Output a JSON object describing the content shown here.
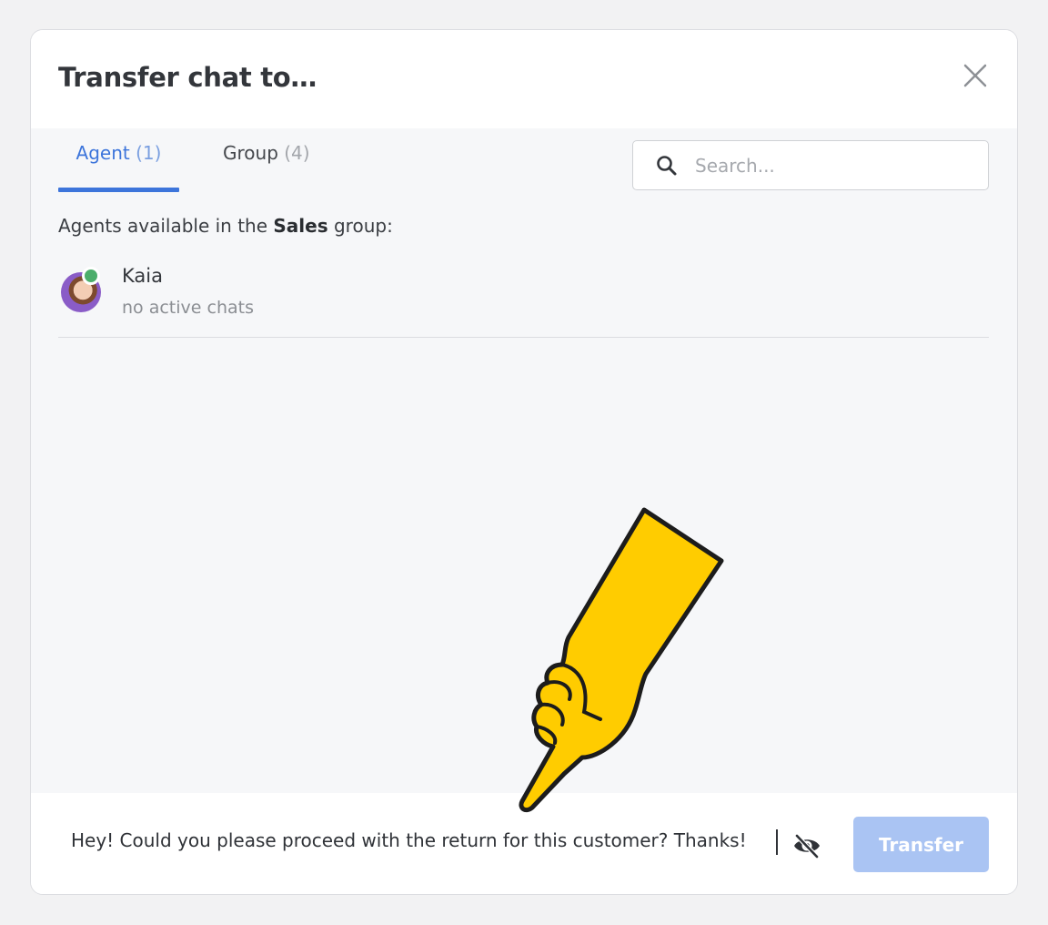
{
  "modal": {
    "title": "Transfer chat to…"
  },
  "tabs": [
    {
      "label": "Agent",
      "count": "(1)",
      "active": true
    },
    {
      "label": "Group",
      "count": "(4)",
      "active": false
    }
  ],
  "search": {
    "placeholder": "Search...",
    "value": ""
  },
  "caption": {
    "prefix": "Agents available in the ",
    "group_name": "Sales",
    "suffix": " group:"
  },
  "agents": [
    {
      "name": "Kaia",
      "status": "no active chats",
      "online": true
    }
  ],
  "footer": {
    "message": "Hey! Could you please proceed with the return for this customer? Thanks!",
    "transfer_label": "Transfer"
  },
  "colors": {
    "accent": "#3d75db",
    "transfer_disabled": "#aac4f3",
    "online": "#4cae6b",
    "hand": "#ffcc00"
  },
  "icons": [
    "close-icon",
    "search-icon",
    "eye-off-icon",
    "pointing-hand-icon"
  ]
}
